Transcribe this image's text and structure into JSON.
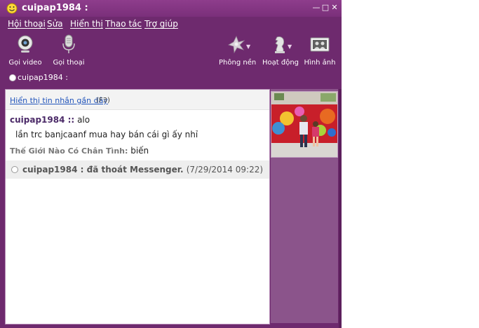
{
  "window": {
    "title": "cuipap1984 :",
    "controls": {
      "minimize": "—",
      "maximize": "□",
      "close": "✕"
    }
  },
  "menu": [
    "Hội thoại",
    "Sửa",
    "Hiển thị",
    "Thao tác",
    "Trợ giúp"
  ],
  "toolbar": {
    "video_call": "Gọi video",
    "voice_call": "Gọi thoại",
    "background": "Phông nền",
    "activity": "Hoạt động",
    "photos": "Hình ảnh"
  },
  "status": {
    "name": "cuipap1984 :"
  },
  "chat": {
    "recent_link": "Hiển thị tin nhắn gần đây",
    "recent_key": "(F3)",
    "messages": [
      {
        "nick": "cuipap1984 ::",
        "text": "alo"
      },
      {
        "nick": "",
        "text": "lần trc banjcaanf mua hay bán cái gì ấy nhỉ"
      },
      {
        "nick": "Thế Giới Nào Có Chân Tình:",
        "text": "biến"
      }
    ],
    "system": {
      "text": "cuipap1984 : đã thoát Messenger.",
      "time": "(7/29/2014 09:22)"
    }
  },
  "colors": {
    "window_bg": "#6e2a6e",
    "titlebar": "#8e3d8c",
    "sidebar": "#8b548b",
    "link": "#2255bb"
  }
}
